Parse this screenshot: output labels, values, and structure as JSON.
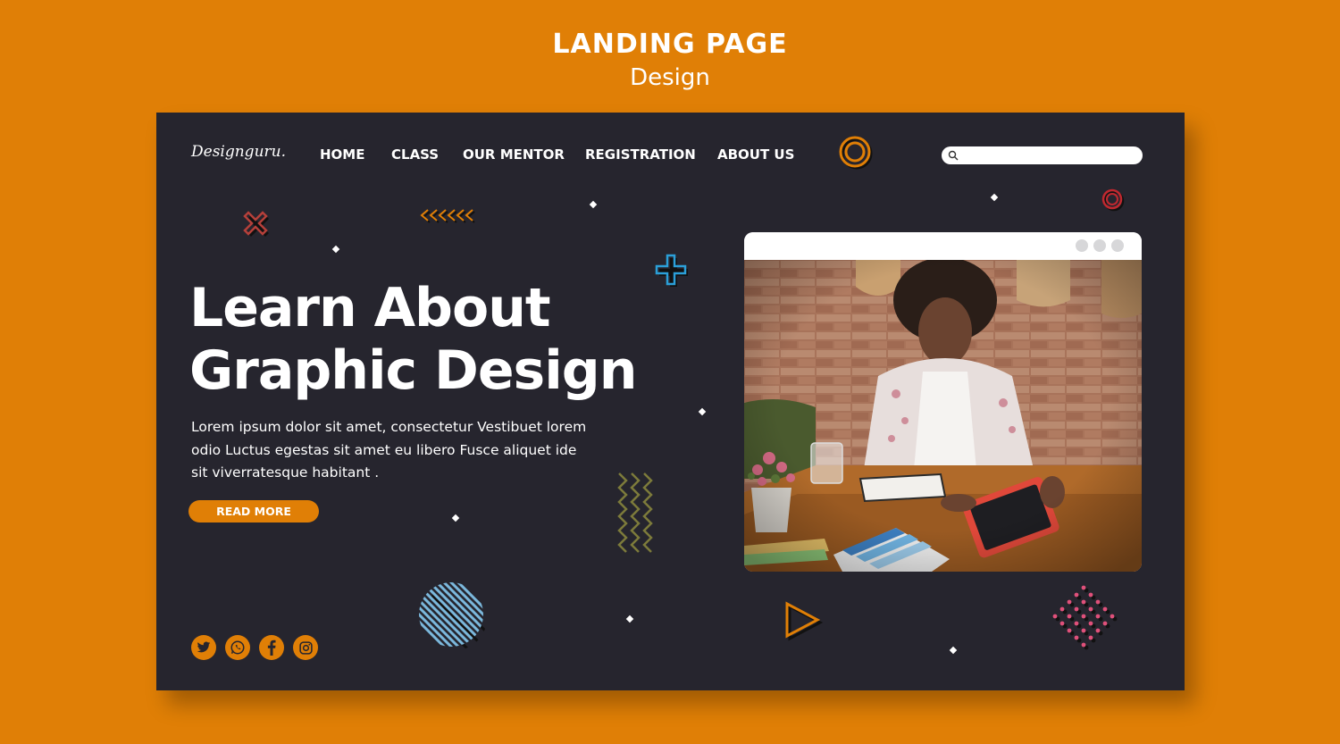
{
  "heading": {
    "title": "LANDING PAGE",
    "subtitle": "Design"
  },
  "brand": {
    "logo": "Designguru."
  },
  "nav": {
    "items": [
      "HOME",
      "CLASS",
      "OUR MENTOR",
      "REGISTRATION",
      "ABOUT US"
    ]
  },
  "search": {
    "placeholder": ""
  },
  "hero": {
    "title_line1": "Learn About",
    "title_line2": "Graphic Design",
    "body_line1": "Lorem ipsum dolor sit amet, consectetur Vestibuet lorem",
    "body_line2": "odio Luctus egestas sit amet eu libero Fusce aliquet ide",
    "body_line3": "sit viverratesque habitant .",
    "cta_label": "READ MORE"
  },
  "social": [
    "twitter-icon",
    "whatsapp-icon",
    "facebook-icon",
    "instagram-icon"
  ],
  "colors": {
    "accent": "#E07F06",
    "panel": "#26252E",
    "text": "#FFFFFF"
  }
}
